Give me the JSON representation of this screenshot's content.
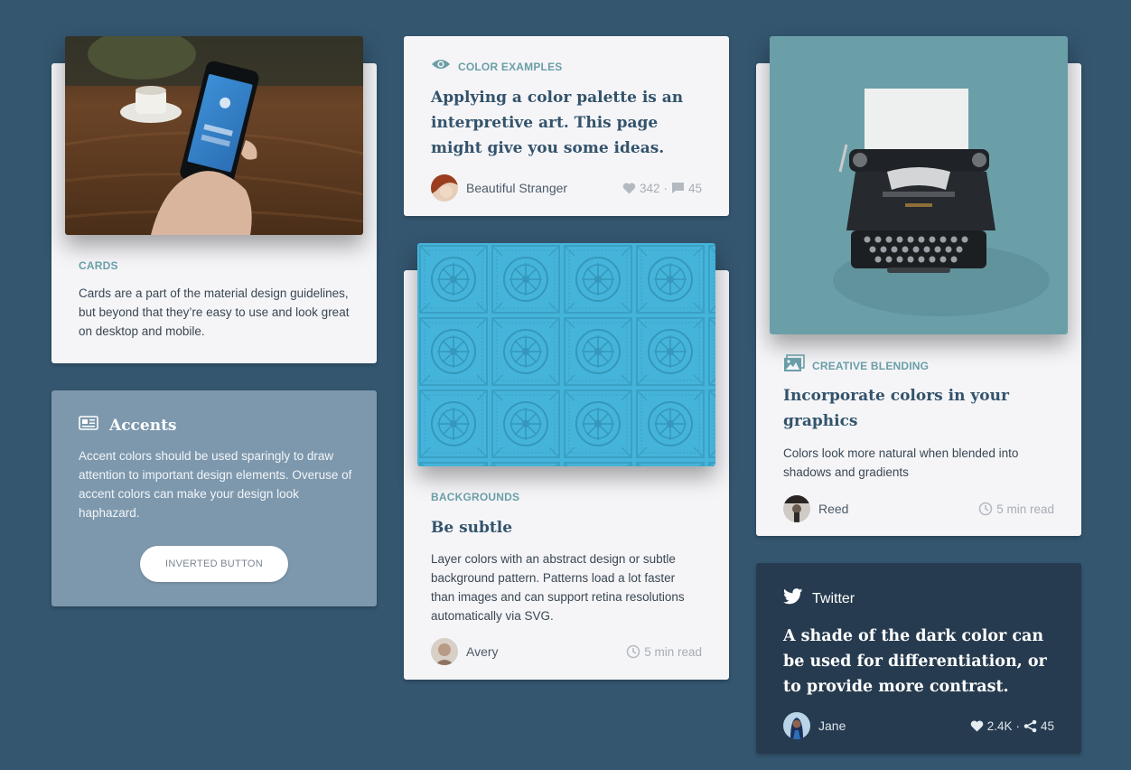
{
  "cards": {
    "cards_card": {
      "eyebrow": "CARDS",
      "body": "Cards are a part of the material design guidelines, but beyond that they’re easy to use and look great on desktop and mobile."
    },
    "accents": {
      "title": "Accents",
      "body": "Accent colors should be used sparingly to draw attention to important design elements. Overuse of accent colors can make your design look haphazard.",
      "button_label": "INVERTED BUTTON"
    },
    "color_examples": {
      "eyebrow": "COLOR EXAMPLES",
      "title": "Applying a color palette is an interpretive art. This page might give you some ideas.",
      "author": "Beautiful Stranger",
      "likes": "342",
      "separator": "·",
      "comments": "45"
    },
    "backgrounds": {
      "eyebrow": "BACKGROUNDS",
      "title": "Be subtle",
      "body": "Layer colors with an abstract design or subtle background pattern. Patterns load a lot faster than images and can support retina resolutions automatically via SVG.",
      "author": "Avery",
      "read_time": "5 min read"
    },
    "creative_blending": {
      "eyebrow": "CREATIVE BLENDING",
      "title": "Incorporate colors in your graphics",
      "body": "Colors look more natural when blended into shadows and gradients",
      "author": "Reed",
      "read_time": "5 min read"
    },
    "twitter": {
      "label": "Twitter",
      "title": "A shade of the dark color can be used for differentiation, or to provide more contrast.",
      "author": "Jane",
      "likes": "2.4K",
      "separator": "·",
      "shares": "45"
    }
  },
  "colors": {
    "page_background": "#34566f",
    "card_background": "#f5f5f8",
    "accent_card": "#7d98ad",
    "dark_card": "#263b4f",
    "eyebrow": "#6a9ea7",
    "title": "#33536b"
  },
  "icons": {
    "color_examples": "eye-icon",
    "creative_blending": "images-icon",
    "accents": "newspaper-icon",
    "twitter": "twitter-icon",
    "likes": "heart-icon",
    "comments": "comment-icon",
    "shares": "share-icon",
    "read_time": "clock-icon"
  }
}
